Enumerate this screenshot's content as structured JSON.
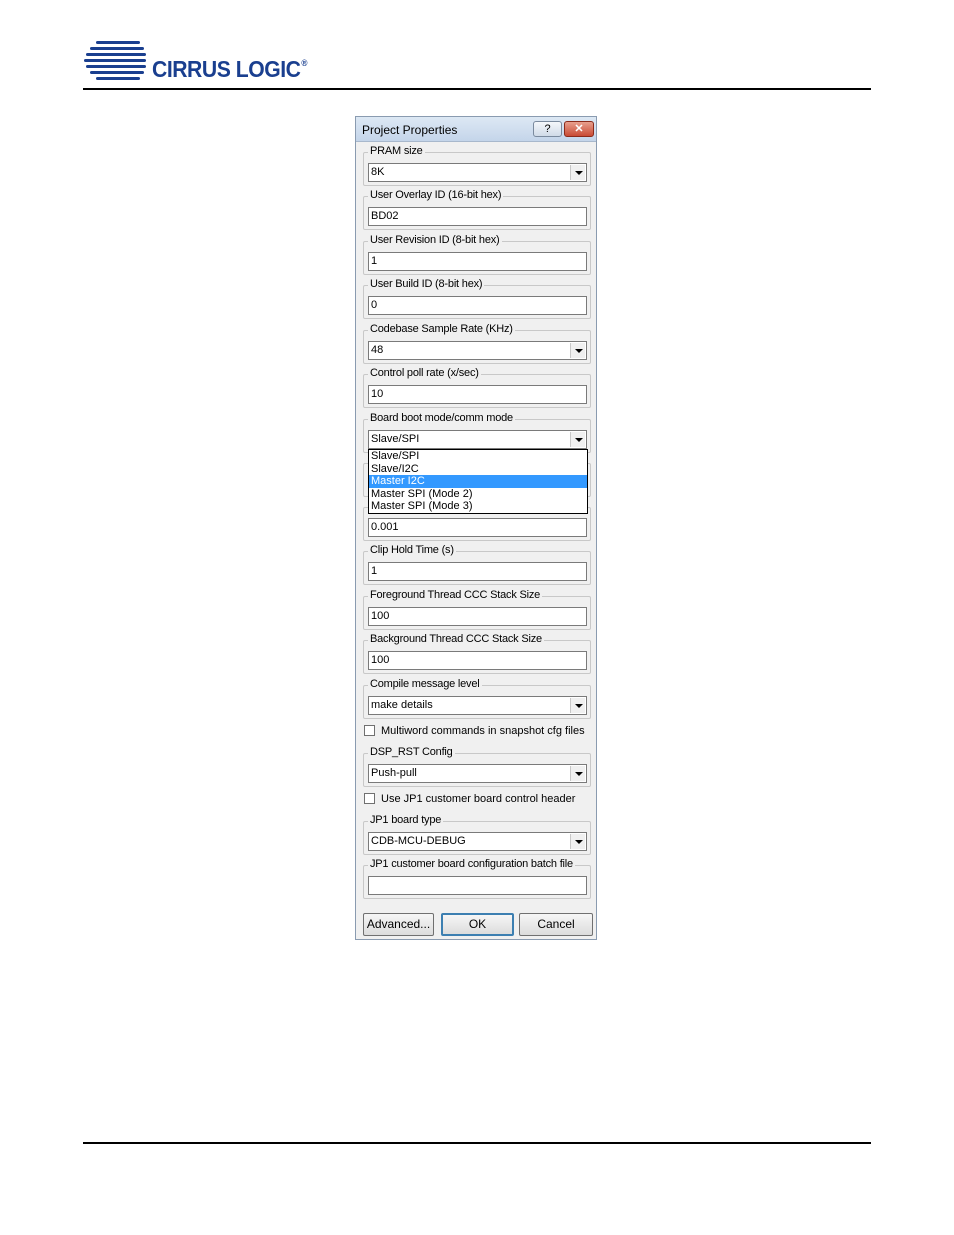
{
  "header": {
    "brand": "CIRRUS LOGIC",
    "brand_mark": "®"
  },
  "dialog": {
    "title": "Project Properties",
    "help_glyph": "?",
    "close_glyph": "✕",
    "groups": [
      {
        "label": "PRAM size",
        "value": "8K"
      },
      {
        "label": "User Overlay ID (16-bit hex)",
        "value": "BD02"
      },
      {
        "label": "User Revision ID (8-bit hex)",
        "value": "1"
      },
      {
        "label": "User Build ID (8-bit hex)",
        "value": "0"
      },
      {
        "label": "Codebase Sample Rate (KHz)",
        "value": "48"
      },
      {
        "label": "Control poll rate (x/sec)",
        "value": "10"
      },
      {
        "label": "Board boot mode/comm mode",
        "value": "Slave/SPI"
      },
      {
        "value": "0.001"
      },
      {
        "label": "Clip Hold Time (s)",
        "value": "1"
      },
      {
        "label": "Foreground Thread CCC Stack Size",
        "value": "100"
      },
      {
        "label": "Background Thread CCC Stack Size",
        "value": "100"
      },
      {
        "label": "Compile message level",
        "value": "make details"
      },
      {
        "label": "DSP_RST Config",
        "value": "Push-pull"
      },
      {
        "label": "JP1 board type",
        "value": "CDB-MCU-DEBUG"
      },
      {
        "label": "JP1 customer board configuration batch file",
        "value": ""
      }
    ],
    "dropdown_options": [
      "Slave/SPI",
      "Slave/I2C",
      "Master I2C",
      "Master SPI (Mode 2)",
      "Master SPI (Mode 3)"
    ],
    "dropdown_selected_index": 2,
    "checkboxes": [
      {
        "label": "Multiword commands in snapshot cfg files",
        "checked": false
      },
      {
        "label": "Use JP1 customer board control header",
        "checked": false
      }
    ],
    "buttons": {
      "advanced": "Advanced...",
      "ok": "OK",
      "cancel": "Cancel"
    }
  }
}
